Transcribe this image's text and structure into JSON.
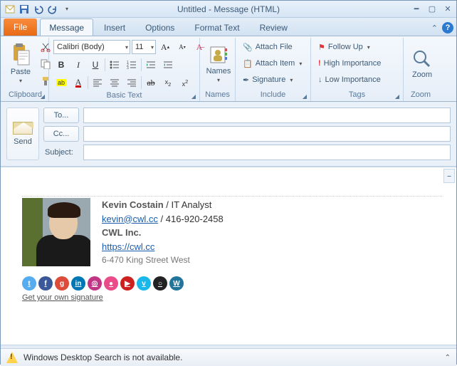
{
  "window": {
    "title": "Untitled - Message (HTML)"
  },
  "tabs": {
    "file": "File",
    "items": [
      "Message",
      "Insert",
      "Options",
      "Format Text",
      "Review"
    ],
    "activeIndex": 0
  },
  "ribbon": {
    "clipboard": {
      "paste": "Paste",
      "label": "Clipboard"
    },
    "basicText": {
      "font": "Calibri (Body)",
      "size": "11",
      "label": "Basic Text"
    },
    "names": {
      "names": "Names",
      "label": "Names"
    },
    "include": {
      "attachFile": "Attach File",
      "attachItem": "Attach Item",
      "signature": "Signature",
      "label": "Include"
    },
    "tags": {
      "followUp": "Follow Up",
      "highImportance": "High Importance",
      "lowImportance": "Low Importance",
      "label": "Tags"
    },
    "zoom": {
      "zoom": "Zoom",
      "label": "Zoom"
    }
  },
  "compose": {
    "send": "Send",
    "to": "To...",
    "cc": "Cc...",
    "subject": "Subject:",
    "toValue": "",
    "ccValue": "",
    "subjectValue": ""
  },
  "signature": {
    "name": "Kevin Costain",
    "roleSep": " / ",
    "role": "IT Analyst",
    "email": "kevin@cwl.cc",
    "phoneSep": " / ",
    "phone": "416-920-2458",
    "company": "CWL Inc.",
    "url": "https://cwl.cc",
    "address": "6-470 King Street West",
    "getYourOwn": "Get your own signature",
    "social": [
      {
        "name": "twitter",
        "bg": "#55acee",
        "glyph": "t"
      },
      {
        "name": "facebook",
        "bg": "#3b5998",
        "glyph": "f"
      },
      {
        "name": "google-plus",
        "bg": "#dd4b39",
        "glyph": "g"
      },
      {
        "name": "linkedin",
        "bg": "#0077b5",
        "glyph": "in"
      },
      {
        "name": "instagram",
        "bg": "#c13584",
        "glyph": "◎"
      },
      {
        "name": "dribbble",
        "bg": "#ea4c89",
        "glyph": "●"
      },
      {
        "name": "youtube",
        "bg": "#cd201f",
        "glyph": "▶"
      },
      {
        "name": "vimeo",
        "bg": "#1ab7ea",
        "glyph": "v"
      },
      {
        "name": "github",
        "bg": "#222222",
        "glyph": "○"
      },
      {
        "name": "wordpress",
        "bg": "#21759b",
        "glyph": "W"
      }
    ]
  },
  "status": {
    "message": "Windows Desktop Search is not available."
  }
}
